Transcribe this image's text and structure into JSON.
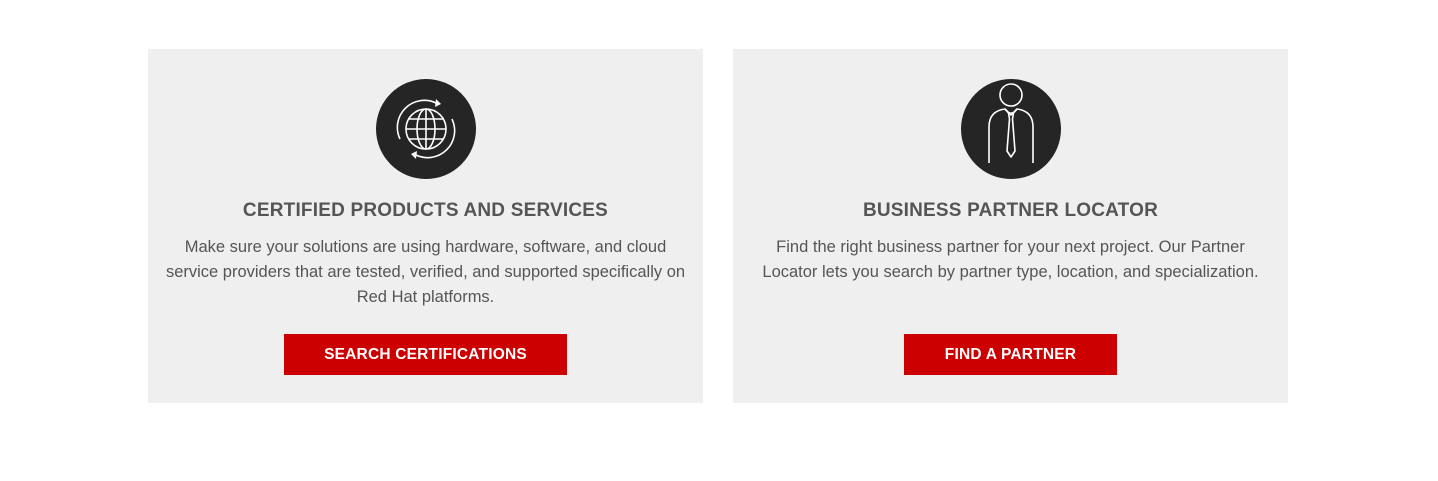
{
  "cards": [
    {
      "icon": "globe-icon",
      "title": "CERTIFIED PRODUCTS AND SERVICES",
      "description": "Make sure your solutions are using hardware, software, and cloud service providers that are tested, verified, and supported specifically on Red Hat platforms.",
      "button_label": "SEARCH CERTIFICATIONS"
    },
    {
      "icon": "business-person-icon",
      "title": "BUSINESS PARTNER LOCATOR",
      "description": "Find the right business partner for your next project. Our Partner Locator lets you search by partner type, location, and specialization.",
      "button_label": "FIND A PARTNER"
    }
  ],
  "colors": {
    "card_background": "#efefef",
    "icon_background": "#252525",
    "text": "#555555",
    "button": "#cc0000",
    "button_text": "#ffffff"
  }
}
